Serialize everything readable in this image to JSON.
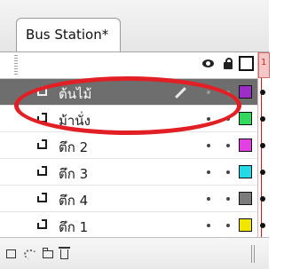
{
  "panel": {
    "tab_label": "Bus Station*"
  },
  "header": {
    "frame_number": "1"
  },
  "layers": [
    {
      "name": "ต้นไม้",
      "color": "#9b2ec6",
      "selected": true
    },
    {
      "name": "ม้านั่ง",
      "color": "#33d95f",
      "selected": false
    },
    {
      "name": "ตึก 2",
      "color": "#e240e0",
      "selected": false
    },
    {
      "name": "ตึก 3",
      "color": "#26d9e6",
      "selected": false
    },
    {
      "name": "ตึก 4",
      "color": "#7b7b7b",
      "selected": false
    },
    {
      "name": "ตึก 1",
      "color": "#f0e600",
      "selected": false
    }
  ],
  "colors": {
    "highlight_oval": "#e11f24",
    "selected_row": "#6e6e6e",
    "playhead": "#d11111"
  },
  "icons": {
    "header": [
      "eye-icon",
      "lock-icon",
      "outline-icon"
    ],
    "bottom": [
      "new-layer-icon",
      "motion-guide-icon",
      "folder-icon",
      "trash-icon"
    ]
  }
}
